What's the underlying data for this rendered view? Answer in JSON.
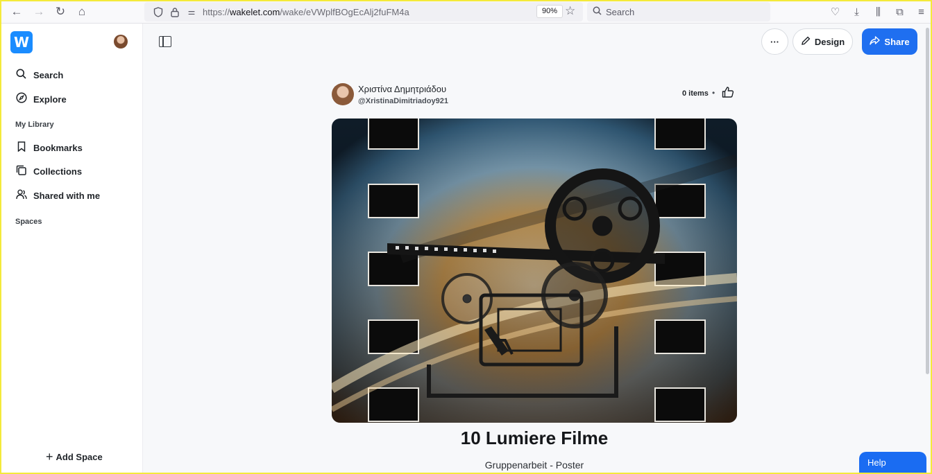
{
  "browser": {
    "url_prefix": "https://",
    "url_domain": "wakelet.com",
    "url_path": "/wake/eVWplfBOgEcAlj2fuFM4a",
    "zoom": "90%",
    "search_placeholder": "Search"
  },
  "sidebar": {
    "logo": "W",
    "items": [
      {
        "label": "Search",
        "icon": "search-icon"
      },
      {
        "label": "Explore",
        "icon": "compass-icon"
      }
    ],
    "section_library": "My Library",
    "library_items": [
      {
        "label": "Bookmarks",
        "icon": "bookmark-icon"
      },
      {
        "label": "Collections",
        "icon": "collections-icon"
      },
      {
        "label": "Shared with me",
        "icon": "users-icon"
      }
    ],
    "section_spaces": "Spaces",
    "add_space": "Add Space"
  },
  "toolbar": {
    "more_label": "···",
    "design_label": "Design",
    "share_label": "Share"
  },
  "collection": {
    "author_name": "Χριστίνα Δημητριάδου",
    "author_handle": "@XristinaDimitriadoy921",
    "items_count": "0 items",
    "separator": "•",
    "title": "10 Lumiere Filme",
    "subtitle": "Gruppenarbeit - Poster"
  },
  "help": {
    "label": "Help"
  },
  "colors": {
    "accent": "#1f6ff0",
    "logo": "#1a8cff",
    "frame": "#f4ea3a"
  }
}
